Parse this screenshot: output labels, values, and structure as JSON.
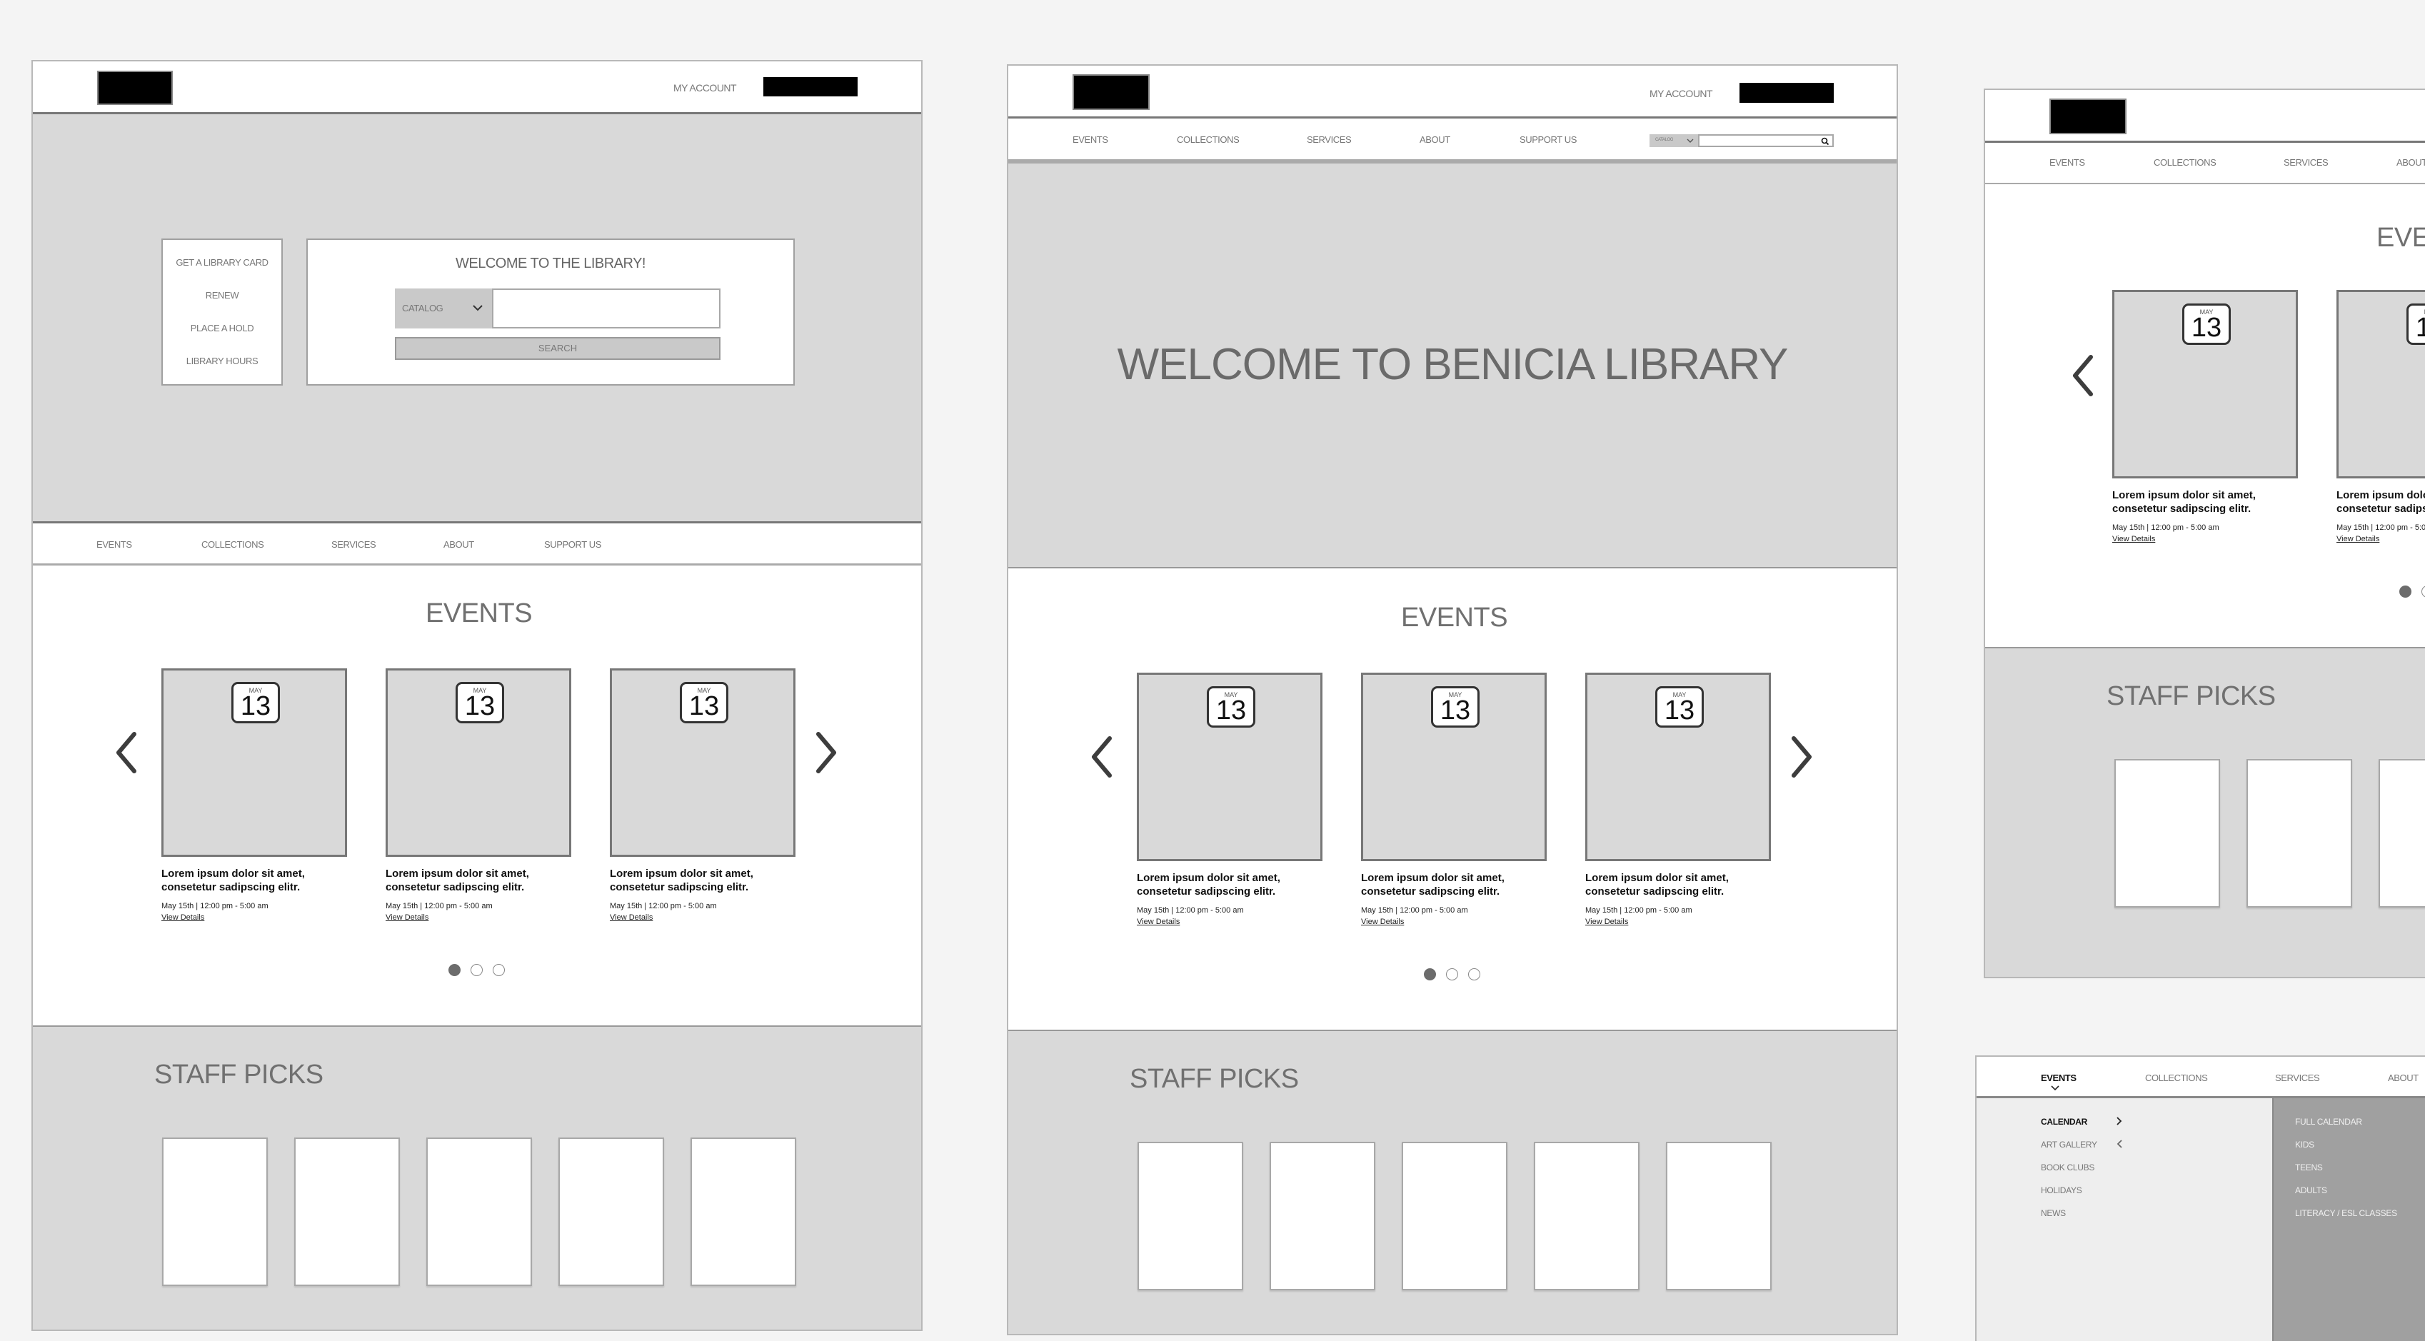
{
  "header": {
    "my_account": "MY ACCOUNT"
  },
  "nav": [
    "EVENTS",
    "COLLECTIONS",
    "SERVICES",
    "ABOUT",
    "SUPPORT US"
  ],
  "quick_links": [
    "GET A LIBRARY CARD",
    "RENEW",
    "PLACE A HOLD",
    "LIBRARY HOURS"
  ],
  "welcome_box": {
    "title": "WELCOME TO THE LIBRARY!",
    "search_scope": "CATALOG",
    "search_value": "",
    "search_button": "SEARCH"
  },
  "hero": {
    "title": "WELCOME TO BENICIA LIBRARY"
  },
  "events": {
    "title": "EVENTS",
    "cards": [
      {
        "month": "MAY",
        "day": "13",
        "title_line1": "Lorem ipsum dolor sit amet,",
        "title_line2": "consetetur sadipscing elitr.",
        "time": "May 15th | 12:00 pm - 5:00 am",
        "link": "View Details"
      },
      {
        "month": "MAY",
        "day": "13",
        "title_line1": "Lorem ipsum dolor sit amet,",
        "title_line2": "consetetur sadipscing elitr.",
        "time": "May 15th | 12:00 pm - 5:00 am",
        "link": "View Details"
      },
      {
        "month": "MAY",
        "day": "13",
        "title_line1": "Lorem ipsum dolor sit amet,",
        "title_line2": "consetetur sadipscing elitr.",
        "time": "May 15th | 12:00 pm - 5:00 am",
        "link": "View Details"
      }
    ],
    "pagination": {
      "pages": 3,
      "active": 1
    }
  },
  "staff_picks": {
    "title": "STAFF PICKS",
    "count": 5
  },
  "dropdown": {
    "active_nav": "EVENTS",
    "nav": [
      "EVENTS",
      "COLLECTIONS",
      "SERVICES",
      "ABOUT"
    ],
    "menu": [
      {
        "label": "CALENDAR",
        "active": true,
        "chevron": "right"
      },
      {
        "label": "ART GALLERY",
        "active": false,
        "chevron": "left"
      },
      {
        "label": "BOOK CLUBS",
        "active": false
      },
      {
        "label": "HOLIDAYS",
        "active": false
      },
      {
        "label": "NEWS",
        "active": false
      }
    ],
    "submenu": [
      "FULL CALENDAR",
      "KIDS",
      "TEENS",
      "ADULTS",
      "LITERACY / ESL CLASSES"
    ]
  },
  "icons": {
    "prev": "chevron-left-icon",
    "next": "chevron-right-icon",
    "dropdown": "chevron-down-icon",
    "search": "search-icon"
  }
}
